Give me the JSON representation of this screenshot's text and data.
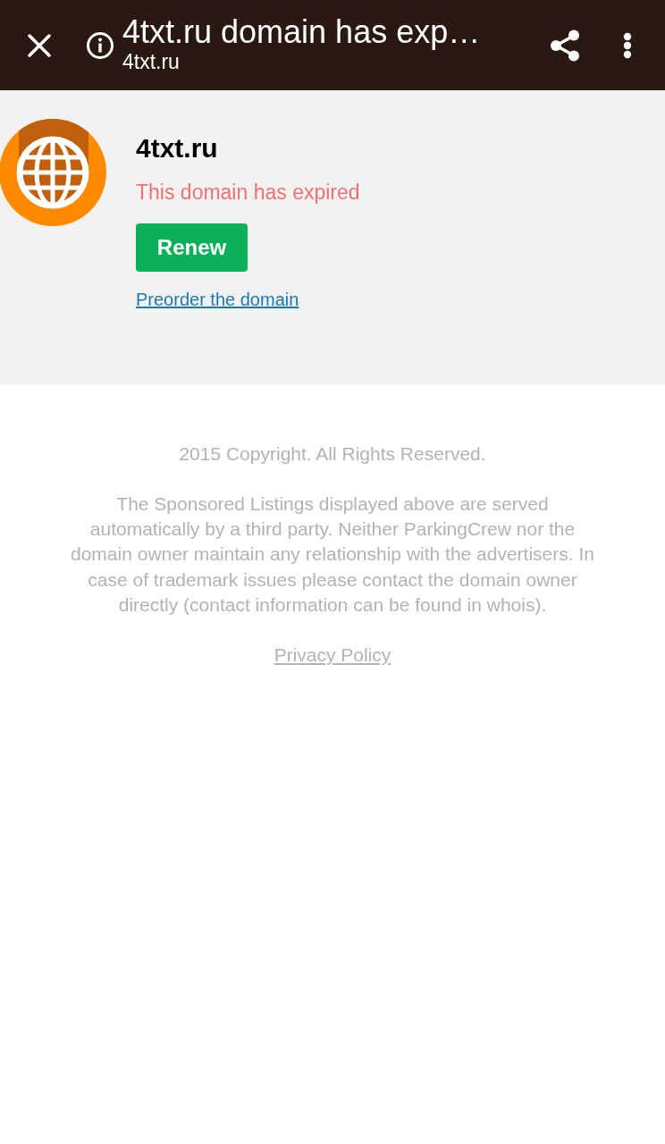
{
  "toolbar": {
    "title": "4txt.ru domain has exp…",
    "url": "4txt.ru"
  },
  "domain_card": {
    "domain": "4txt.ru",
    "status": "This domain has expired",
    "primary_button": "Renew",
    "link": "Preorder the domain"
  },
  "footer": {
    "copyright": "2015 Copyright. All Rights Reserved.",
    "disclaimer": "The Sponsored Listings displayed above are served automatically by a third party. Neither ParkingCrew nor the domain owner maintain any relationship with the advertisers. In case of trademark issues please contact the domain owner directly (contact information can be found in whois).",
    "privacy_link": "Privacy Policy"
  }
}
